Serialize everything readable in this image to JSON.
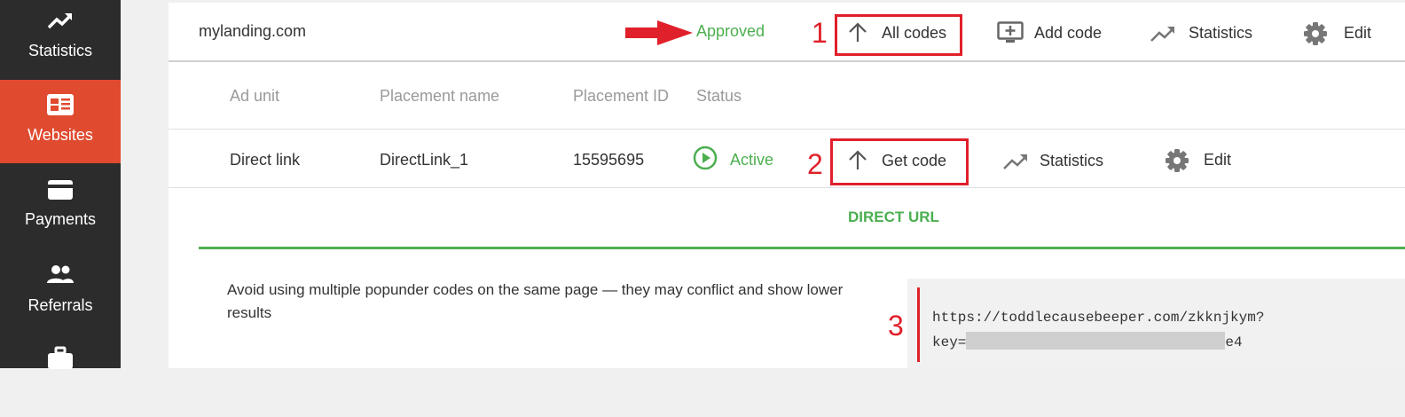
{
  "sidebar": {
    "items": [
      {
        "label": "Statistics",
        "icon": "trending-up-icon"
      },
      {
        "label": "Websites",
        "icon": "website-icon",
        "active": true
      },
      {
        "label": "Payments",
        "icon": "card-icon"
      },
      {
        "label": "Referrals",
        "icon": "people-icon"
      },
      {
        "label": "",
        "icon": "briefcase-icon"
      }
    ]
  },
  "site": {
    "name": "mylanding.com",
    "status": "Approved",
    "actions": {
      "all_codes": "All codes",
      "add_code": "Add code",
      "statistics": "Statistics",
      "edit": "Edit"
    }
  },
  "table": {
    "headers": [
      "Ad unit",
      "Placement name",
      "Placement ID",
      "Status"
    ],
    "row": {
      "ad_unit": "Direct link",
      "placement_name": "DirectLink_1",
      "placement_id": "15595695",
      "status": "Active",
      "actions": {
        "get_code": "Get code",
        "statistics": "Statistics",
        "edit": "Edit"
      }
    }
  },
  "direct_url": {
    "tab_label": "DIRECT URL",
    "note": "Avoid using multiple popunder codes on the same page — they may conflict and show lower results",
    "code_line1": "https://toddlecausebeeper.com/zkknjkym?",
    "code_line2_prefix": "key=",
    "code_line2_suffix": "e4"
  },
  "annotations": {
    "n1": "1",
    "n2": "2",
    "n3": "3"
  },
  "colors": {
    "sidebar_bg": "#2c2c2c",
    "active_item": "#e04a2f",
    "green": "#4caf50",
    "annotation_red": "#e0202a"
  }
}
